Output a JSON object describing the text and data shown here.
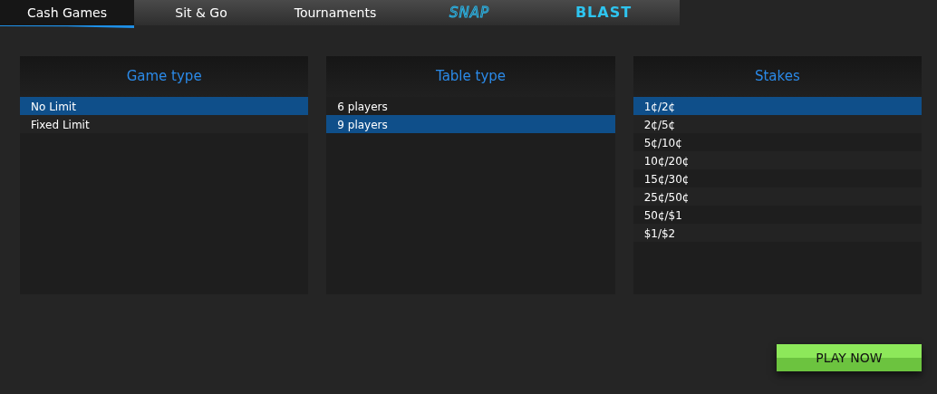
{
  "tabs": [
    {
      "label": "Cash Games",
      "kind": "text",
      "selected": true
    },
    {
      "label": "Sit & Go",
      "kind": "text",
      "selected": false
    },
    {
      "label": "Tournaments",
      "kind": "text",
      "selected": false
    },
    {
      "label": "SNAP",
      "kind": "snap-logo",
      "selected": false
    },
    {
      "label": "BLAST",
      "kind": "blast-logo",
      "selected": false
    }
  ],
  "panels": [
    {
      "title": "Game type",
      "items": [
        {
          "label": "No Limit",
          "selected": true
        },
        {
          "label": "Fixed Limit",
          "selected": false
        }
      ]
    },
    {
      "title": "Table type",
      "items": [
        {
          "label": "6 players",
          "selected": false
        },
        {
          "label": "9 players",
          "selected": true
        }
      ]
    },
    {
      "title": "Stakes",
      "items": [
        {
          "label": "1¢/2¢",
          "selected": true
        },
        {
          "label": "2¢/5¢",
          "selected": false
        },
        {
          "label": "5¢/10¢",
          "selected": false
        },
        {
          "label": "10¢/20¢",
          "selected": false
        },
        {
          "label": "15¢/30¢",
          "selected": false
        },
        {
          "label": "25¢/50¢",
          "selected": false
        },
        {
          "label": "50¢/$1",
          "selected": false
        },
        {
          "label": "$1/$2",
          "selected": false
        }
      ]
    }
  ],
  "play_button": "PLAY NOW"
}
